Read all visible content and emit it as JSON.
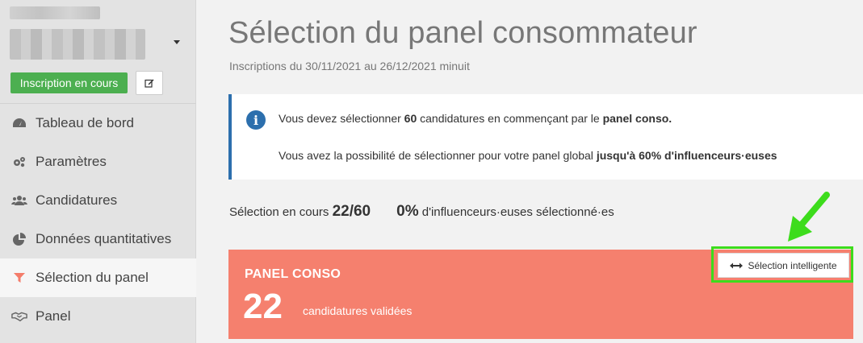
{
  "sidebar": {
    "status_badge": "Inscription en cours",
    "items": [
      {
        "label": "Tableau de bord",
        "icon": "dashboard-icon"
      },
      {
        "label": "Paramètres",
        "icon": "gears-icon"
      },
      {
        "label": "Candidatures",
        "icon": "users-icon"
      },
      {
        "label": "Données quantitatives",
        "icon": "pie-chart-icon"
      },
      {
        "label": "Sélection du panel",
        "icon": "filter-icon",
        "active": true
      },
      {
        "label": "Panel",
        "icon": "handshake-icon"
      }
    ]
  },
  "main": {
    "title": "Sélection du panel consommateur",
    "subtitle": "Inscriptions du 30/11/2021 au 26/12/2021 minuit",
    "info": {
      "line1_pre": "Vous devez sélectionner ",
      "line1_count": "60",
      "line1_mid": " candidatures en commençant par le ",
      "line1_bold": "panel conso.",
      "line2_pre": "Vous avez la possibilité de sélectionner pour votre panel global ",
      "line2_bold": "jusqu'à 60% d'influenceurs·euses"
    },
    "stats": {
      "selection_label": "Sélection en cours ",
      "selection_value": "22/60",
      "influencer_pct": "0%",
      "influencer_label": " d'influenceurs·euses sélectionné·es"
    },
    "panel_card": {
      "title": "PANEL CONSO",
      "count": "22",
      "caption": "candidatures validées",
      "smart_button": "Sélection intelligente"
    }
  },
  "colors": {
    "accent_green": "#4caf50",
    "info_blue": "#2c6fad",
    "panel_salmon": "#f5806e",
    "highlight_green": "#3ddc1c"
  }
}
